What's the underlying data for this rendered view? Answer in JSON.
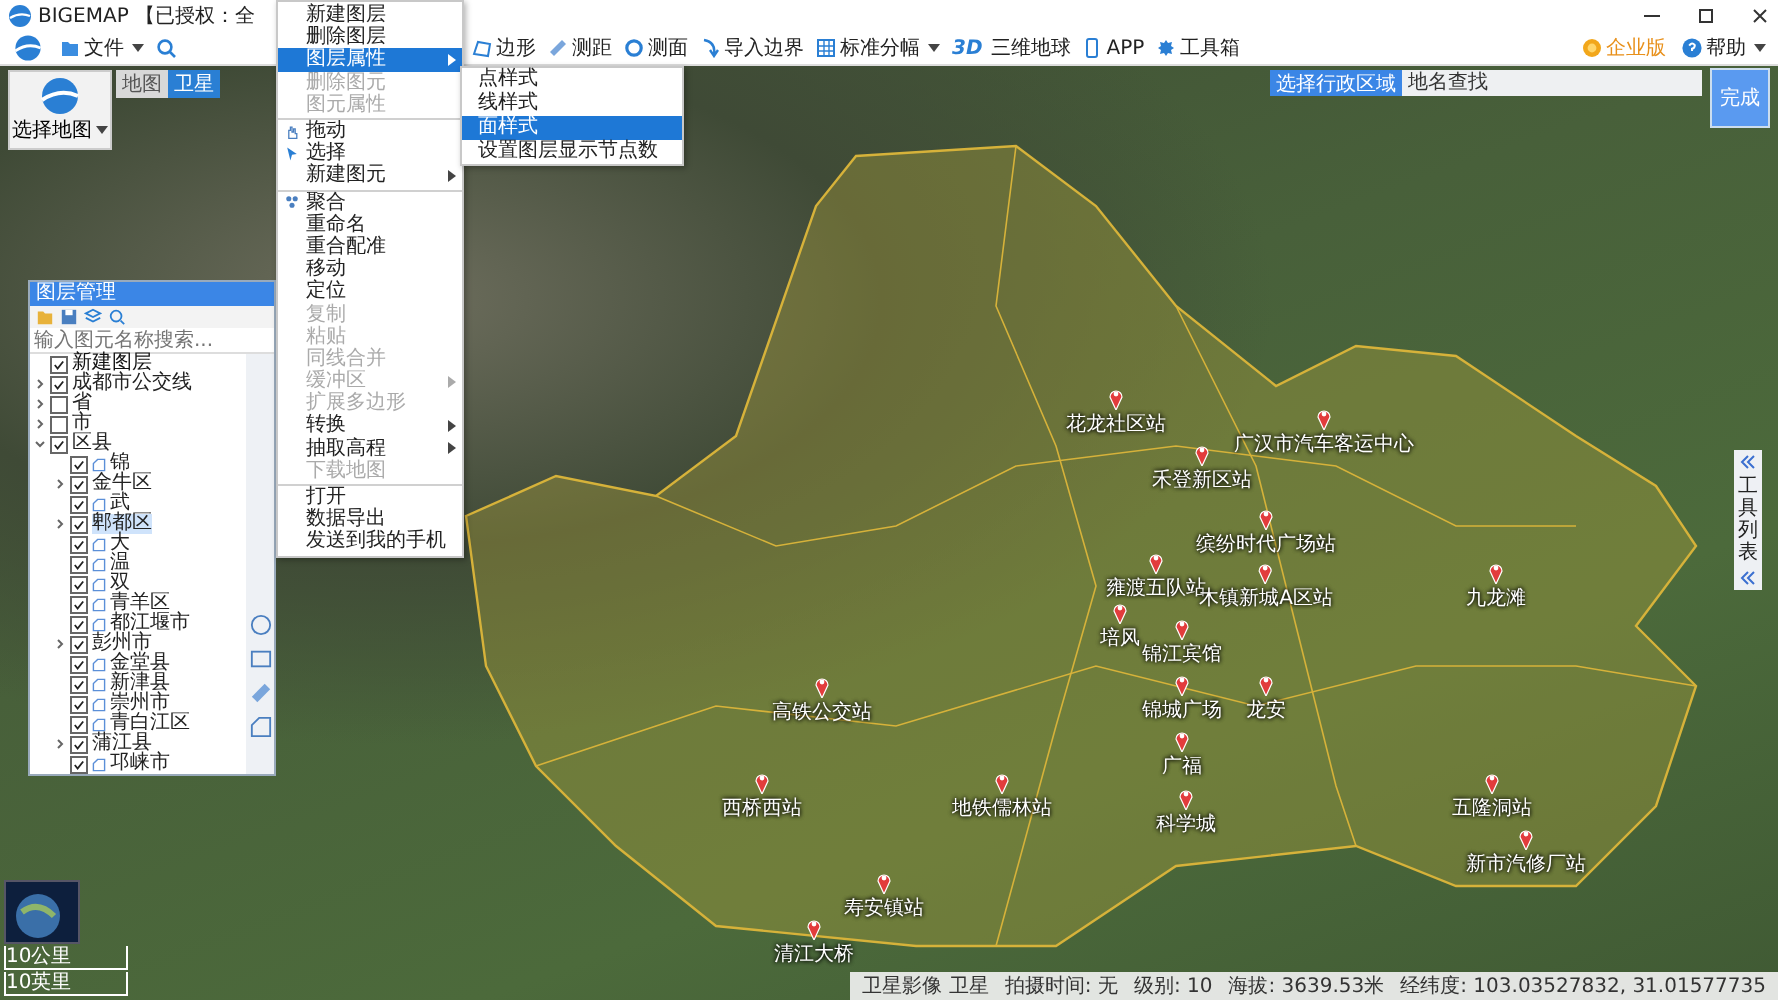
{
  "window": {
    "app_name": "BIGEMAP",
    "title": "【已授权：全"
  },
  "toolbar": {
    "left": [
      {
        "label": "文件",
        "dropdown": true
      }
    ],
    "right": [
      {
        "label": "边形",
        "dropdown": false
      },
      {
        "label": "测距",
        "dropdown": false
      },
      {
        "label": "测面",
        "dropdown": false
      },
      {
        "label": "导入边界",
        "dropdown": false
      },
      {
        "label": "标准分幅",
        "dropdown": true
      },
      {
        "label": "三维地球",
        "badge": "3D",
        "dropdown": false
      },
      {
        "label": "APP",
        "dropdown": false
      },
      {
        "label": "工具箱",
        "dropdown": false
      }
    ],
    "edition": "企业版",
    "help": "帮助"
  },
  "map_select": {
    "label": "选择地图",
    "tabs": [
      {
        "label": "地图",
        "selected": false
      },
      {
        "label": "卫星",
        "selected": true
      }
    ]
  },
  "region_search": {
    "button": "选择行政区域",
    "placeholder": "地名查找",
    "done": "完成"
  },
  "context_menu": [
    {
      "label": "新建图层",
      "disabled": false,
      "submenu": false,
      "selected": false,
      "separator_before": false
    },
    {
      "label": "删除图层",
      "disabled": false,
      "submenu": false,
      "selected": false,
      "separator_before": false
    },
    {
      "label": "图层属性",
      "disabled": false,
      "submenu": true,
      "selected": true,
      "separator_before": false
    },
    {
      "label": "删除图元",
      "disabled": true,
      "submenu": false,
      "selected": false,
      "separator_before": false
    },
    {
      "label": "图元属性",
      "disabled": true,
      "submenu": false,
      "selected": false,
      "separator_before": false
    },
    {
      "label": "拖动",
      "disabled": false,
      "submenu": false,
      "selected": false,
      "separator_before": true
    },
    {
      "label": "选择",
      "disabled": false,
      "submenu": false,
      "selected": false,
      "separator_before": false
    },
    {
      "label": "新建图元",
      "disabled": false,
      "submenu": true,
      "selected": false,
      "separator_before": false
    },
    {
      "label": "聚合",
      "disabled": false,
      "submenu": false,
      "selected": false,
      "separator_before": true
    },
    {
      "label": "重命名",
      "disabled": false,
      "submenu": false,
      "selected": false,
      "separator_before": false
    },
    {
      "label": "重合配准",
      "disabled": false,
      "submenu": false,
      "selected": false,
      "separator_before": false
    },
    {
      "label": "移动",
      "disabled": false,
      "submenu": false,
      "selected": false,
      "separator_before": false
    },
    {
      "label": "定位",
      "disabled": false,
      "submenu": false,
      "selected": false,
      "separator_before": false
    },
    {
      "label": "复制",
      "disabled": true,
      "submenu": false,
      "selected": false,
      "separator_before": false
    },
    {
      "label": "粘贴",
      "disabled": true,
      "submenu": false,
      "selected": false,
      "separator_before": false
    },
    {
      "label": "同线合并",
      "disabled": true,
      "submenu": false,
      "selected": false,
      "separator_before": false
    },
    {
      "label": "缓冲区",
      "disabled": true,
      "submenu": true,
      "selected": false,
      "separator_before": false
    },
    {
      "label": "扩展多边形",
      "disabled": true,
      "submenu": false,
      "selected": false,
      "separator_before": false
    },
    {
      "label": "转换",
      "disabled": false,
      "submenu": true,
      "selected": false,
      "separator_before": false
    },
    {
      "label": "抽取高程",
      "disabled": false,
      "submenu": true,
      "selected": false,
      "separator_before": false
    },
    {
      "label": "下载地图",
      "disabled": true,
      "submenu": false,
      "selected": false,
      "separator_before": false
    },
    {
      "label": "打开",
      "disabled": false,
      "submenu": false,
      "selected": false,
      "separator_before": true
    },
    {
      "label": "数据导出",
      "disabled": false,
      "submenu": false,
      "selected": false,
      "separator_before": false
    },
    {
      "label": "发送到我的手机",
      "disabled": false,
      "submenu": false,
      "selected": false,
      "separator_before": false
    }
  ],
  "submenu": [
    {
      "label": "点样式",
      "selected": false
    },
    {
      "label": "线样式",
      "selected": false
    },
    {
      "label": "面样式",
      "selected": true
    },
    {
      "label": "设置图层显示节点数",
      "selected": false
    }
  ],
  "layer_panel": {
    "title": "图层管理",
    "search_placeholder": "输入图元名称搜索...",
    "tree": [
      {
        "label": "新建图层",
        "kind": "layer",
        "checked": true,
        "selected": false
      },
      {
        "label": "成都市公交线",
        "kind": "group",
        "checked": true,
        "selected": false,
        "expanded": false
      },
      {
        "label": "省",
        "kind": "group",
        "checked": false,
        "selected": false,
        "expanded": false
      },
      {
        "label": "市",
        "kind": "group",
        "checked": false,
        "selected": false,
        "expanded": false
      },
      {
        "label": "区县",
        "kind": "group",
        "checked": true,
        "selected": false,
        "expanded": true,
        "children": [
          {
            "label": "锦",
            "kind": "area",
            "checked": true,
            "selected": false
          },
          {
            "label": "金牛区",
            "kind": "group",
            "checked": true,
            "selected": false,
            "expanded": false
          },
          {
            "label": "武",
            "kind": "area",
            "checked": true,
            "selected": false
          },
          {
            "label": "郫都区",
            "kind": "group",
            "checked": true,
            "selected": true,
            "expanded": false
          },
          {
            "label": "大",
            "kind": "area",
            "checked": true,
            "selected": false
          },
          {
            "label": "温",
            "kind": "area",
            "checked": true,
            "selected": false
          },
          {
            "label": "双",
            "kind": "area",
            "checked": true,
            "selected": false
          },
          {
            "label": "青羊区",
            "kind": "area",
            "checked": true,
            "selected": false
          },
          {
            "label": "都江堰市",
            "kind": "area",
            "checked": true,
            "selected": false
          },
          {
            "label": "彭州市",
            "kind": "group",
            "checked": true,
            "selected": false,
            "expanded": false
          },
          {
            "label": "金堂县",
            "kind": "area",
            "checked": true,
            "selected": false
          },
          {
            "label": "新津县",
            "kind": "area",
            "checked": true,
            "selected": false
          },
          {
            "label": "崇州市",
            "kind": "area",
            "checked": true,
            "selected": false
          },
          {
            "label": "青白江区",
            "kind": "area",
            "checked": true,
            "selected": false
          },
          {
            "label": "蒲江县",
            "kind": "group",
            "checked": true,
            "selected": false,
            "expanded": false
          },
          {
            "label": "邛崃市",
            "kind": "area",
            "checked": true,
            "selected": false
          }
        ]
      }
    ]
  },
  "map_labels": [
    "花龙社区站",
    "广汉市汽车客运中心",
    "禾登新区站",
    "缤纷时代广场站",
    "雍渡五队站",
    "木镇新城A区站",
    "九龙滩",
    "培风",
    "锦江宾馆",
    "高铁公交站",
    "锦城广场",
    "龙安",
    "广福",
    "科学城",
    "西桥西站",
    "地铁儒林站",
    "五隆洞站",
    "新市汽修厂站",
    "寿安镇站",
    "清江大桥"
  ],
  "side_tab": "工具列表",
  "scale": [
    "10公里",
    "10英里"
  ],
  "status_bar": [
    "卫星影像 卫星",
    "拍摄时间: 无",
    "级别: 10",
    "海拔: 3639.53米",
    "经纬度: 103.03527832, 31.01577735"
  ]
}
